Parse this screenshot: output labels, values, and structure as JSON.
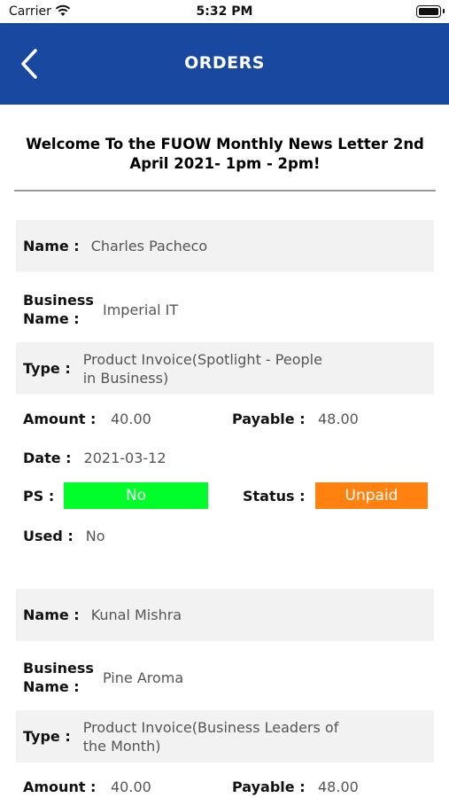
{
  "status_bar": {
    "carrier": "Carrier",
    "time": "5:32 PM"
  },
  "nav": {
    "title": "ORDERS"
  },
  "headline": "Welcome To the FUOW Monthly News Letter 2nd April 2021- 1pm - 2pm!",
  "labels": {
    "name": "Name :",
    "business_line1": "Business",
    "business_line2": "Name :",
    "type": "Type :",
    "amount": "Amount :",
    "payable": "Payable :",
    "date": "Date :",
    "ps": "PS :",
    "status": "Status :",
    "used": "Used :"
  },
  "orders": [
    {
      "name": "Charles Pacheco",
      "business_name": "Imperial IT",
      "type_line1": "Product Invoice(Spotlight - People",
      "type_line2": "in Business)",
      "amount": "40.00",
      "payable": "48.00",
      "date": "2021-03-12",
      "ps": "No",
      "status": "Unpaid",
      "used": "No"
    },
    {
      "name": "Kunal Mishra",
      "business_name": "Pine Aroma",
      "type_line1": "Product Invoice(Business Leaders of",
      "type_line2": "the Month)",
      "amount": "40.00",
      "payable": "48.00"
    }
  ],
  "colors": {
    "nav": "#1848a0",
    "ps_badge": "#00ff2a",
    "status_badge": "#ff8210",
    "row_shade": "#f2f2f2"
  }
}
